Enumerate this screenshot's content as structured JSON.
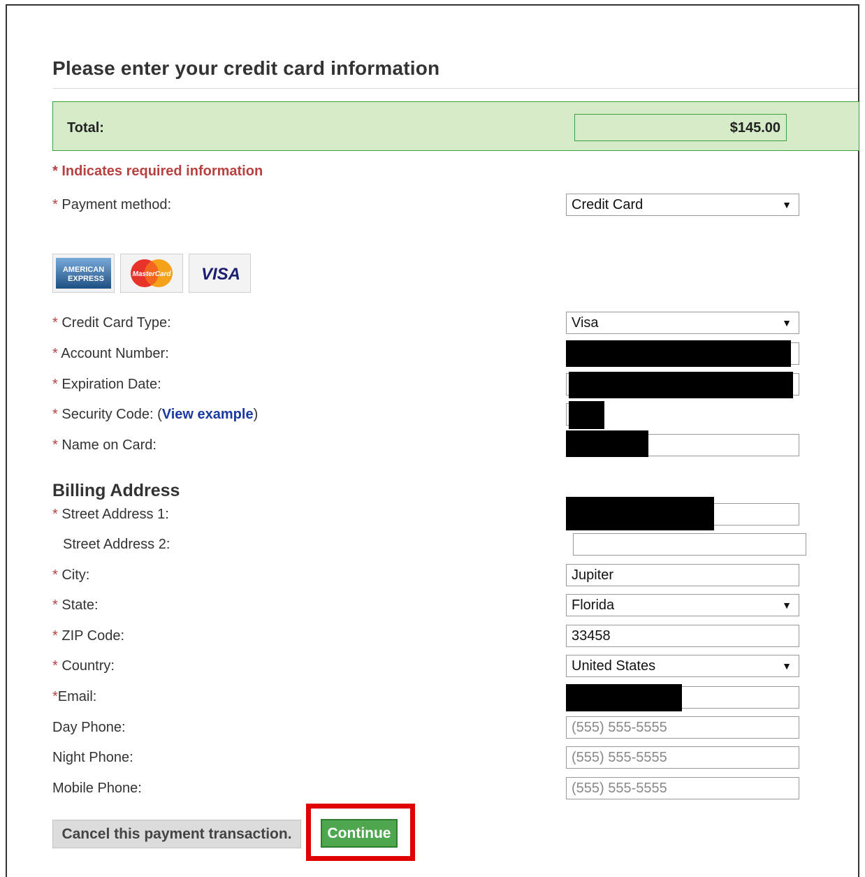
{
  "page": {
    "title": "Please enter your credit card information"
  },
  "total": {
    "label": "Total:",
    "value": "$145.00"
  },
  "required_note": "* Indicates required information",
  "payment_method": {
    "star": "*",
    "label": "Payment method:",
    "value": "Credit Card"
  },
  "card_logos": {
    "amex_line1": "AMERICAN",
    "amex_line2": "EXPRESS",
    "mastercard": "MasterCard",
    "visa": "VISA"
  },
  "fields": {
    "card_type": {
      "star": "*",
      "label": "Credit Card Type:",
      "value": "Visa"
    },
    "account_number": {
      "star": "*",
      "label": "Account Number:",
      "value": ""
    },
    "expiration_date": {
      "star": "*",
      "label": "Expiration Date:",
      "value": ""
    },
    "security_code": {
      "star": "*",
      "label_prefix": "Security Code: (",
      "link": "View example",
      "label_suffix": ")",
      "value": ""
    },
    "name_on_card": {
      "star": "*",
      "label": "Name on Card:",
      "value": ""
    }
  },
  "billing": {
    "heading": "Billing Address",
    "street1": {
      "star": "*",
      "label": "Street Address 1:",
      "value": ""
    },
    "street2": {
      "label": "Street Address 2:",
      "value": ""
    },
    "city": {
      "star": "*",
      "label": "City:",
      "value": "Jupiter"
    },
    "state": {
      "star": "*",
      "label": "State:",
      "value": "Florida"
    },
    "zip": {
      "star": "*",
      "label": "ZIP Code:",
      "value": "33458"
    },
    "country": {
      "star": "*",
      "label": "Country:",
      "value": "United States"
    },
    "email": {
      "star": "*",
      "label": "Email:",
      "value": ""
    },
    "day_phone": {
      "label": "Day Phone:",
      "placeholder": "(555) 555-5555"
    },
    "night_phone": {
      "label": "Night Phone:",
      "placeholder": "(555) 555-5555"
    },
    "mobile_phone": {
      "label": "Mobile Phone:",
      "placeholder": "(555) 555-5555"
    }
  },
  "buttons": {
    "cancel": "Cancel this payment transaction.",
    "continue": "Continue"
  },
  "colors": {
    "required_red": "#b94040",
    "total_bg": "#d6ecc9",
    "continue_green": "#4ea64e",
    "highlight_red": "#e00000",
    "link_blue": "#1a3aa0"
  }
}
